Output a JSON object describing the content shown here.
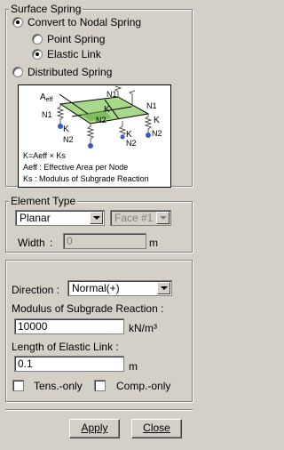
{
  "surface_spring": {
    "title": "Surface Spring",
    "convert_to_nodal": "Convert to Nodal Spring",
    "point_spring": "Point Spring",
    "elastic_link": "Elastic Link",
    "distributed_spring": "Distributed Spring",
    "selected": "elastic_link"
  },
  "diagram": {
    "area_label": "A",
    "area_sub": "eff",
    "n1": "N1",
    "n2": "N2",
    "k": "K",
    "formula": "K=Aeff × Ks",
    "aeff_desc": "Aeff : Effective Area per Node",
    "ks_desc": "Ks   : Modulus of Subgrade Reaction"
  },
  "element_type": {
    "title": "Element Type",
    "type_value": "Planar",
    "face_value": "Face #1",
    "width_label": "Width",
    "width_colon": ":",
    "width_value": "0",
    "width_unit": "m"
  },
  "direction": {
    "label": "Direction :",
    "value": "Normal(+)"
  },
  "modulus": {
    "label": "Modulus of Subgrade Reaction :",
    "value": "10000",
    "unit": "kN/m³"
  },
  "length": {
    "label": "Length of Elastic Link :",
    "value": "0.1",
    "unit": "m"
  },
  "options": {
    "tens_only": "Tens.-only",
    "comp_only": "Comp.-only"
  },
  "buttons": {
    "apply": "Apply",
    "close": "Close"
  },
  "colors": {
    "panel": "#d4d0c8",
    "plate_fill": "#9fd27f",
    "spring": "#000000"
  }
}
